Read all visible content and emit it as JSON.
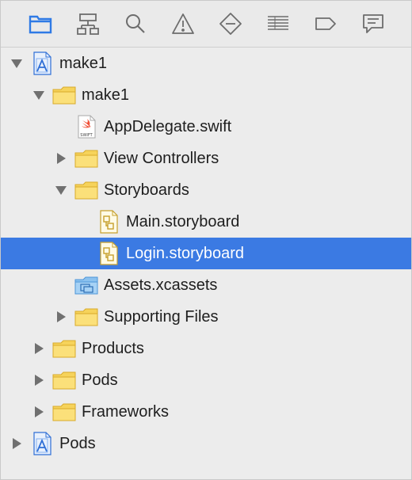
{
  "toolbar": {
    "active_color": "#2f7ae5",
    "icons": [
      "folder-icon",
      "hierarchy-icon",
      "search-icon",
      "warning-icon",
      "breakpoint-icon",
      "list-icon",
      "tag-icon",
      "comment-icon"
    ]
  },
  "tree": {
    "selection_color": "#3b7ae3",
    "items": [
      {
        "label": "make1",
        "kind": "project",
        "depth": 0,
        "disclosure": "expanded"
      },
      {
        "label": "make1",
        "kind": "folder",
        "depth": 1,
        "disclosure": "expanded"
      },
      {
        "label": "AppDelegate.swift",
        "kind": "swift",
        "depth": 2,
        "disclosure": "none"
      },
      {
        "label": "View Controllers",
        "kind": "folder",
        "depth": 2,
        "disclosure": "collapsed"
      },
      {
        "label": "Storyboards",
        "kind": "folder",
        "depth": 2,
        "disclosure": "expanded"
      },
      {
        "label": "Main.storyboard",
        "kind": "storyboard",
        "depth": 3,
        "disclosure": "none"
      },
      {
        "label": "Login.storyboard",
        "kind": "storyboard",
        "depth": 3,
        "disclosure": "none",
        "selected": true
      },
      {
        "label": "Assets.xcassets",
        "kind": "assets",
        "depth": 2,
        "disclosure": "none"
      },
      {
        "label": "Supporting Files",
        "kind": "folder",
        "depth": 2,
        "disclosure": "collapsed"
      },
      {
        "label": "Products",
        "kind": "folder",
        "depth": 1,
        "disclosure": "collapsed"
      },
      {
        "label": "Pods",
        "kind": "folder",
        "depth": 1,
        "disclosure": "collapsed"
      },
      {
        "label": "Frameworks",
        "kind": "folder",
        "depth": 1,
        "disclosure": "collapsed"
      },
      {
        "label": "Pods",
        "kind": "project",
        "depth": 0,
        "disclosure": "collapsed"
      }
    ]
  }
}
